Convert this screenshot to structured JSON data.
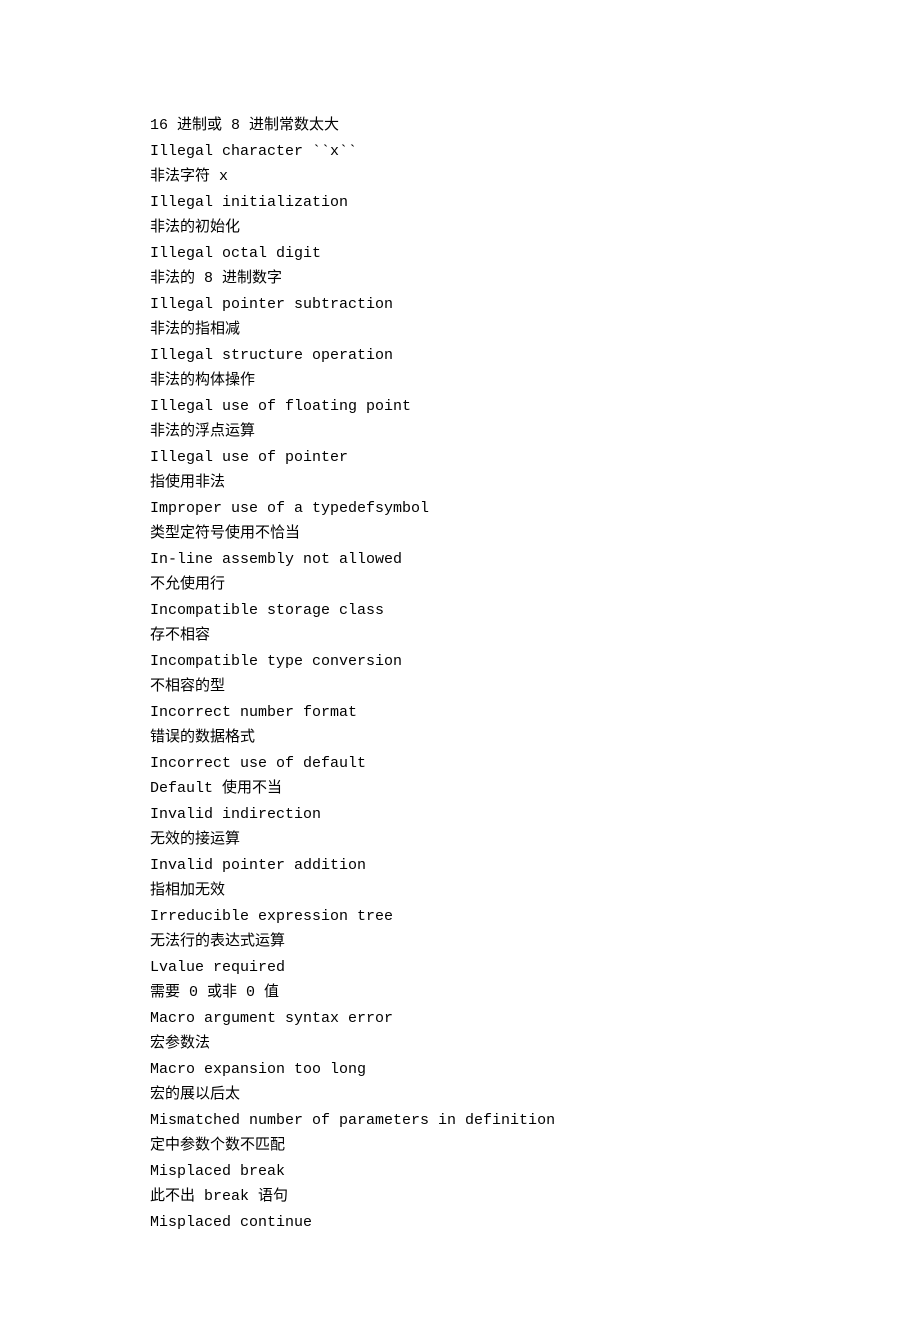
{
  "lines": [
    "16 进制或 8 进制常数太大",
    "Illegal character ``x``",
    "非法字符 x",
    "Illegal initialization",
    "非法的初始化",
    "Illegal octal digit",
    "非法的 8 进制数字",
    "Illegal pointer subtraction",
    "非法的指相减",
    "Illegal structure operation",
    "非法的构体操作",
    "Illegal use of floating point",
    "非法的浮点运算",
    "Illegal use of pointer",
    "指使用非法",
    "Improper use of a typedefsymbol",
    "类型定符号使用不恰当",
    "In-line assembly not allowed",
    "不允使用行",
    "Incompatible storage class",
    "存不相容",
    "Incompatible type conversion",
    "不相容的型",
    "Incorrect number format",
    "错误的数据格式",
    "Incorrect use of default",
    "Default 使用不当",
    "Invalid indirection",
    "无效的接运算",
    "Invalid pointer addition",
    "指相加无效",
    "Irreducible expression tree",
    "无法行的表达式运算",
    "Lvalue required",
    "需要 0 或非 0 值",
    "Macro argument syntax error",
    "宏参数法",
    "Macro expansion too long",
    "宏的展以后太",
    "Mismatched number of parameters in definition",
    "定中参数个数不匹配",
    "Misplaced break",
    "此不出 break 语句",
    "Misplaced continue"
  ]
}
